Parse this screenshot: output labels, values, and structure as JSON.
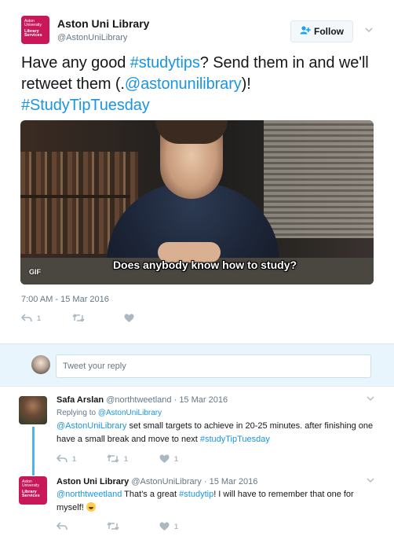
{
  "tweet": {
    "author_name": "Aston Uni Library",
    "author_handle": "@AstonUniLibrary",
    "avatar_lines": [
      "Aston",
      "University",
      "Library",
      "Services"
    ],
    "follow_label": "Follow",
    "text_parts": {
      "p1": "Have any good ",
      "tag1": "#studytips",
      "p2": "? Send them in and we'll retweet them (.",
      "mention": "@astonunilibrary",
      "p3": ")! ",
      "tag2": "#StudyTipTuesday"
    },
    "media_caption": "Does anybody know how to study?",
    "media_badge": "GIF",
    "timestamp": "7:00 AM - 15 Mar 2016",
    "reply_count": "1",
    "retweet_count": "",
    "like_count": ""
  },
  "reply_box": {
    "placeholder": "Tweet your reply"
  },
  "replies": [
    {
      "name": "Safa Arslan",
      "handle": "@northtweetland",
      "date": "15 Mar 2016",
      "replying_prefix": "Replying to ",
      "replying_to": "@AstonUniLibrary",
      "text_mention": "@AstonUniLibrary",
      "text_body": " set small targets to achieve in 20-25 minutes. after finishing one have a small break and move to next ",
      "text_tag": "#studyTipTuesday",
      "reply_count": "1",
      "retweet_count": "1",
      "like_count": "1"
    },
    {
      "name": "Aston Uni Library",
      "handle": "@AstonUniLibrary",
      "date": "15 Mar 2016",
      "text_mention": "@northtweetland",
      "text_p1": " That's a great ",
      "text_tag": "#studytip",
      "text_p2": "! I will have to remember that one for myself! ",
      "reply_count": "",
      "retweet_count": "",
      "like_count": "1"
    }
  ],
  "colors": {
    "brand": "#c8185a",
    "link": "#1b95e0",
    "muted": "#657786",
    "thread_line": "#4ab3f4"
  }
}
